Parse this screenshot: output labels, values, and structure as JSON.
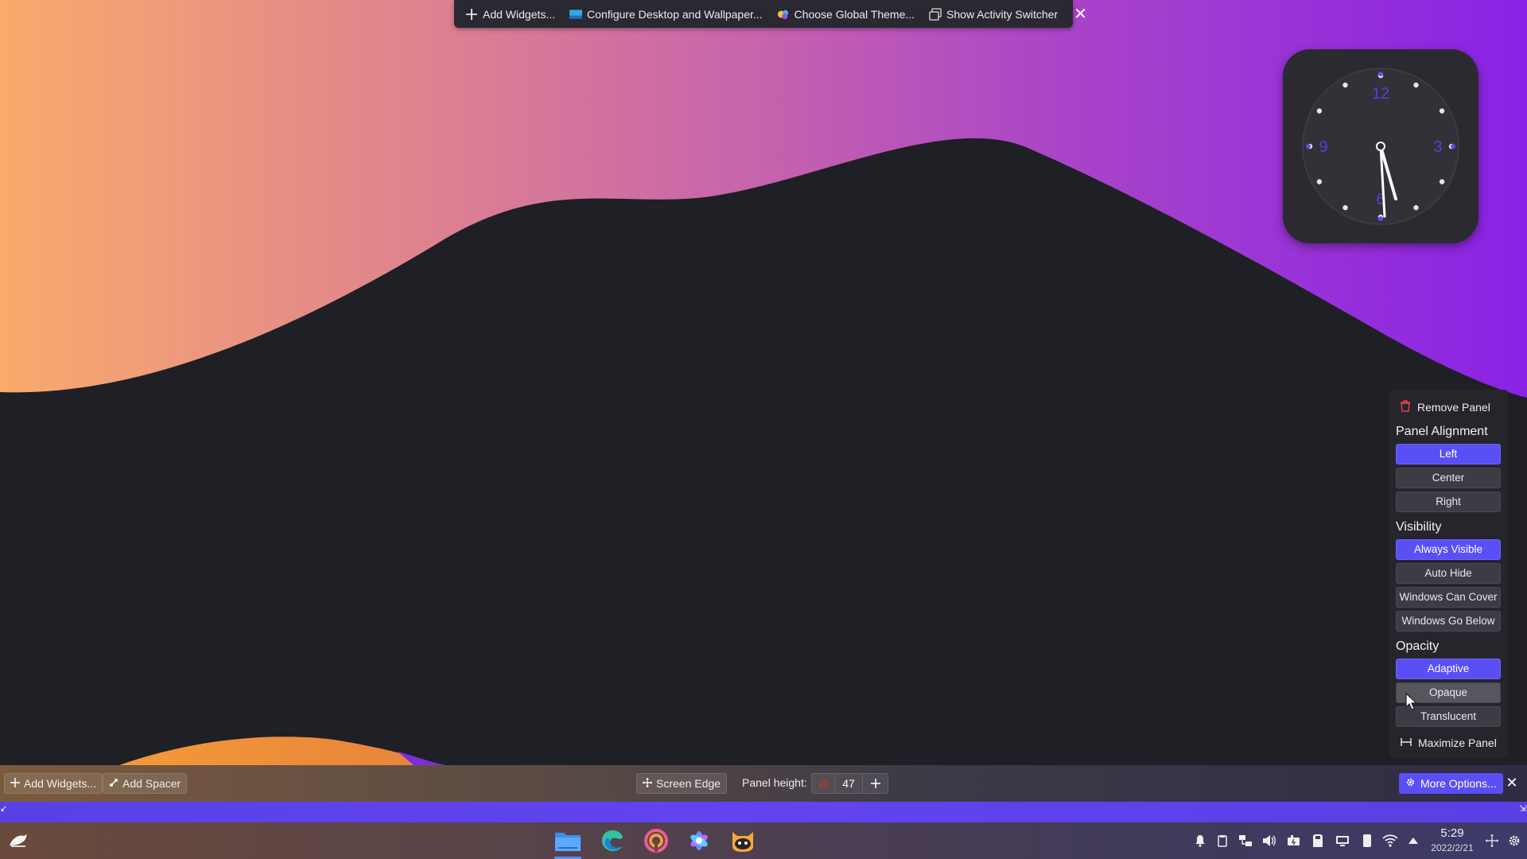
{
  "top_toolbar": {
    "add_widgets": "Add Widgets...",
    "configure_desktop": "Configure Desktop and Wallpaper...",
    "choose_theme": "Choose Global Theme...",
    "activity_switcher": "Show Activity Switcher"
  },
  "clock": {
    "numerals": [
      "12",
      "3",
      "6",
      "9"
    ]
  },
  "panel_options": {
    "remove_panel": "Remove Panel",
    "alignment": {
      "heading": "Panel Alignment",
      "left": "Left",
      "center": "Center",
      "right": "Right",
      "selected": "Left"
    },
    "visibility": {
      "heading": "Visibility",
      "always_visible": "Always Visible",
      "auto_hide": "Auto Hide",
      "windows_can_cover": "Windows Can Cover",
      "windows_go_below": "Windows Go Below",
      "selected": "Always Visible"
    },
    "opacity": {
      "heading": "Opacity",
      "adaptive": "Adaptive",
      "opaque": "Opaque",
      "translucent": "Translucent",
      "selected": "Adaptive"
    },
    "maximize_panel": "Maximize Panel"
  },
  "panel_editbar": {
    "add_widgets": "Add Widgets...",
    "add_spacer": "Add Spacer",
    "screen_edge": "Screen Edge",
    "panel_height_label": "Panel height:",
    "panel_height_value": "47",
    "more_options": "More Options..."
  },
  "taskbar": {
    "tasks": [
      "file-manager-icon",
      "edge-browser-icon",
      "app-circle-icon",
      "photo-app-icon",
      "cat-app-icon"
    ],
    "active_task": "file-manager-icon",
    "tray": [
      "bell-icon",
      "clipboard-icon",
      "network-share-icon",
      "volume-icon",
      "battery-charging-icon",
      "sd-card-icon",
      "display-icon",
      "phone-icon",
      "wifi-icon",
      "expand-tray-icon"
    ],
    "time": "5:29",
    "date": "2022/2/21"
  },
  "colors": {
    "accent": "#5a4ff5",
    "wallpaper_left": "#f8a86a",
    "wallpaper_right": "#8a2be2",
    "dark_dune": "#1f1f26"
  }
}
